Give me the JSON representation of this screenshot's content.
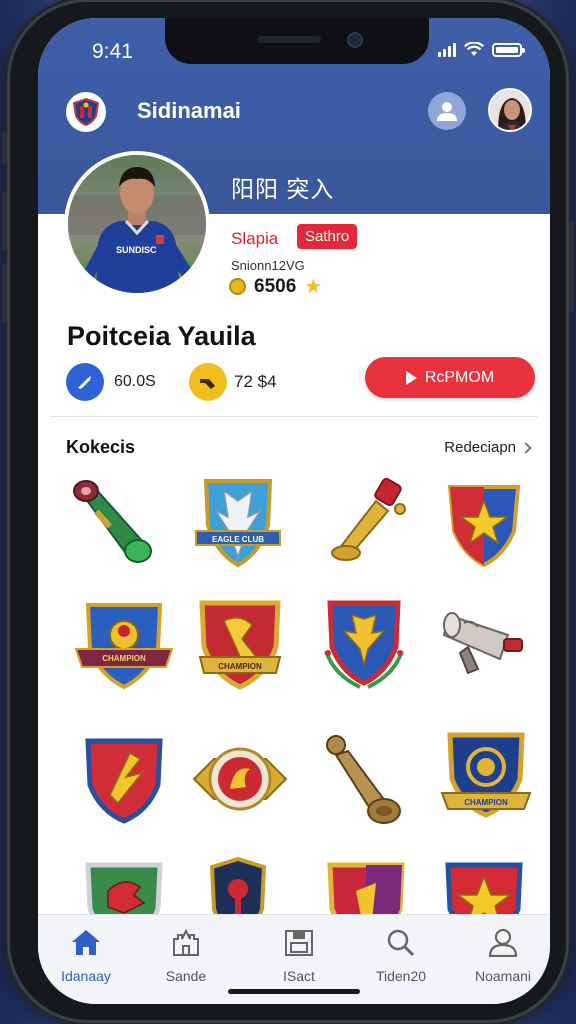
{
  "status_bar": {
    "time": "9:41"
  },
  "header": {
    "title": "Sidinamai",
    "subtitle": "阳阳 突入"
  },
  "player": {
    "rating_name": "Slapia",
    "tag": "Sathro",
    "meta": "Snionn12VG",
    "score": "6506",
    "name": "Poitceia Yauila",
    "stat_blue_value": "60.0S",
    "stat_gold_value": "72 $4",
    "jersey_text": "SUNDISC"
  },
  "promo_button": {
    "label": "RcPMOM"
  },
  "collection": {
    "title": "Kokecis",
    "link_label": "Redeciapn",
    "items": [
      {
        "icon": "green-horn-trophy-icon"
      },
      {
        "icon": "eagle-crest-badge-icon",
        "banner": "EAGLE CLUB"
      },
      {
        "icon": "golden-cup-trophy-icon"
      },
      {
        "icon": "star-shield-badge-icon"
      },
      {
        "icon": "blue-gold-crest-badge-icon",
        "banner": "CHAMPION"
      },
      {
        "icon": "red-gold-crest-badge-icon",
        "banner": "CHAMPION"
      },
      {
        "icon": "laurel-eagle-crest-icon"
      },
      {
        "icon": "silver-cannon-trophy-icon"
      },
      {
        "icon": "red-blue-shield-badge-icon"
      },
      {
        "icon": "red-emblem-coin-icon"
      },
      {
        "icon": "bronze-chess-trophy-icon"
      },
      {
        "icon": "navy-gold-crest-badge-icon",
        "banner": "CHAMPION"
      },
      {
        "icon": "green-dragon-shield-icon"
      },
      {
        "icon": "navy-red-shield-icon"
      },
      {
        "icon": "red-purple-shield-icon"
      },
      {
        "icon": "gold-star-shield-icon"
      }
    ]
  },
  "tabbar": {
    "items": [
      {
        "label": "Idanaay",
        "icon": "home-icon",
        "active": true
      },
      {
        "label": "Sande",
        "icon": "castle-icon",
        "active": false
      },
      {
        "label": "ISact",
        "icon": "archive-icon",
        "active": false
      },
      {
        "label": "Tiden20",
        "icon": "search-icon",
        "active": false
      },
      {
        "label": "Noamani",
        "icon": "profile-icon",
        "active": false
      }
    ]
  },
  "colors": {
    "header_blue": "#3c5ba2",
    "accent_red": "#e8333f",
    "active_blue": "#2f5ec4",
    "gold": "#f0be1f"
  }
}
